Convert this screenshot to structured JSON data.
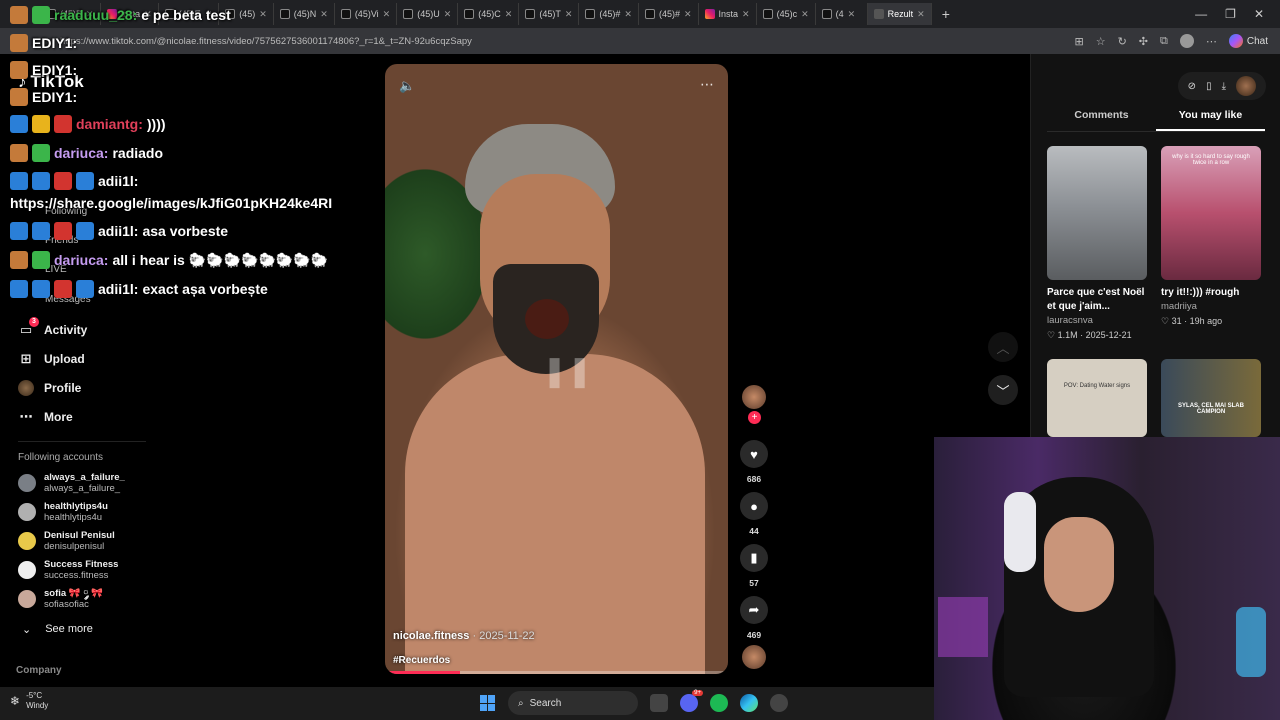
{
  "browser": {
    "tabs": [
      {
        "label": "(45)B",
        "icon": "tiktok"
      },
      {
        "label": "Insta",
        "icon": "instagram"
      },
      {
        "label": "(45)E",
        "icon": "tiktok"
      },
      {
        "label": "(45)",
        "icon": "tiktok"
      },
      {
        "label": "(45)N",
        "icon": "tiktok"
      },
      {
        "label": "(45)Vi",
        "icon": "tiktok"
      },
      {
        "label": "(45)U",
        "icon": "tiktok"
      },
      {
        "label": "(45)C",
        "icon": "tiktok"
      },
      {
        "label": "(45)T",
        "icon": "tiktok"
      },
      {
        "label": "(45)#",
        "icon": "tiktok"
      },
      {
        "label": "(45)#",
        "icon": "tiktok"
      },
      {
        "label": "Insta",
        "icon": "instagram"
      },
      {
        "label": "(45)c",
        "icon": "tiktok"
      },
      {
        "label": "(4",
        "icon": "tiktok"
      },
      {
        "label": "Rezult",
        "icon": "google"
      }
    ],
    "new_tab": "+",
    "url": "https://www.tiktok.com/@nicolae.fitness/video/7575627536001174806?_r=1&_t=ZN-92u6cqzSapy",
    "chat_label": "Chat"
  },
  "sidebar": {
    "logo": "TikTok",
    "faded_items": [
      "Following",
      "Friends",
      "LIVE",
      "Messages"
    ],
    "items": [
      {
        "label": "Activity",
        "icon": "activity-icon",
        "badge": "3"
      },
      {
        "label": "Upload",
        "icon": "upload-icon"
      },
      {
        "label": "Profile",
        "icon": "profile-icon"
      },
      {
        "label": "More",
        "icon": "more-icon"
      }
    ],
    "following_header": "Following accounts",
    "accounts": [
      {
        "name": "always_a_failure_",
        "handle": "always_a_failure_"
      },
      {
        "name": "healthlytips4u",
        "handle": "healthlytips4u"
      },
      {
        "name": "Denisul Penisul",
        "handle": "denisulpenisul"
      },
      {
        "name": "Success Fitness",
        "handle": "success.fitness"
      },
      {
        "name": "sofia 🎀 ༘ 🎀",
        "handle": "sofiasofiac"
      }
    ],
    "see_more": "See more",
    "company": "Company"
  },
  "chat": [
    {
      "user": "raaduuu_28:",
      "text": "e pe beta test",
      "user_color": "#3bb54a"
    },
    {
      "user": "EDIY1:",
      "text": "",
      "user_color": "#ffffff"
    },
    {
      "user": "EDIY1:",
      "text": "",
      "user_color": "#ffffff"
    },
    {
      "user": "EDIY1:",
      "text": "",
      "user_color": "#ffffff"
    },
    {
      "user": "damiantg:",
      "text": "))))",
      "user_color": "#e0405a"
    },
    {
      "user": "dariuca:",
      "text": "radiado",
      "user_color": "#c59cf0"
    },
    {
      "user": "adii1l:",
      "text": "",
      "user_color": "#ffffff"
    },
    {
      "user": "",
      "text": "https://share.google/images/kJfiG01pKH24ke4RI",
      "user_color": "#ffffff"
    },
    {
      "user": "adii1l:",
      "text": "asa vorbeste",
      "user_color": "#ffffff"
    },
    {
      "user": "dariuca:",
      "text": "all i hear is 🐑🐑🐑🐑🐑🐑🐑🐑",
      "user_color": "#c59cf0"
    },
    {
      "user": "adii1l:",
      "text": "exact așa vorbește",
      "user_color": "#ffffff"
    }
  ],
  "video": {
    "author": "nicolae.fitness",
    "date": "2025-11-22",
    "hashtag": "#Recuerdos",
    "progress": 0.22,
    "actions": [
      {
        "name": "like",
        "icon": "heart-icon",
        "glyph": "♥",
        "count": "686"
      },
      {
        "name": "comment",
        "icon": "comment-icon",
        "glyph": "💬",
        "count": "44"
      },
      {
        "name": "save",
        "icon": "bookmark-icon",
        "glyph": "🔖",
        "count": "57"
      },
      {
        "name": "share",
        "icon": "share-icon",
        "glyph": "➦",
        "count": "469"
      }
    ]
  },
  "right_panel": {
    "tabs": [
      "Comments",
      "You may like"
    ],
    "active_tab": "You may like",
    "cards": [
      {
        "title": "Parce que c'est Noël et que j'aim...",
        "author": "lauracsnva",
        "likes": "1.1M",
        "date": "2025-12-21",
        "color": "#8a8f94"
      },
      {
        "title": "try it!!:))) #rough",
        "author": "madriiya",
        "likes": "31",
        "date": "19h ago",
        "color": "#c2547a",
        "overlay": "why is it so hard to say rough twice in a row"
      }
    ],
    "cards_lower": [
      {
        "color": "#d8d1c4",
        "overlay": "POV: Dating Water signs"
      },
      {
        "color": "#4a5a6a",
        "overlay": "SYLAS, CEL MAI SLAB CAMPION"
      }
    ]
  },
  "taskbar": {
    "temp": "-5°C",
    "condition": "Windy",
    "search": "Search",
    "badge": "9+"
  }
}
